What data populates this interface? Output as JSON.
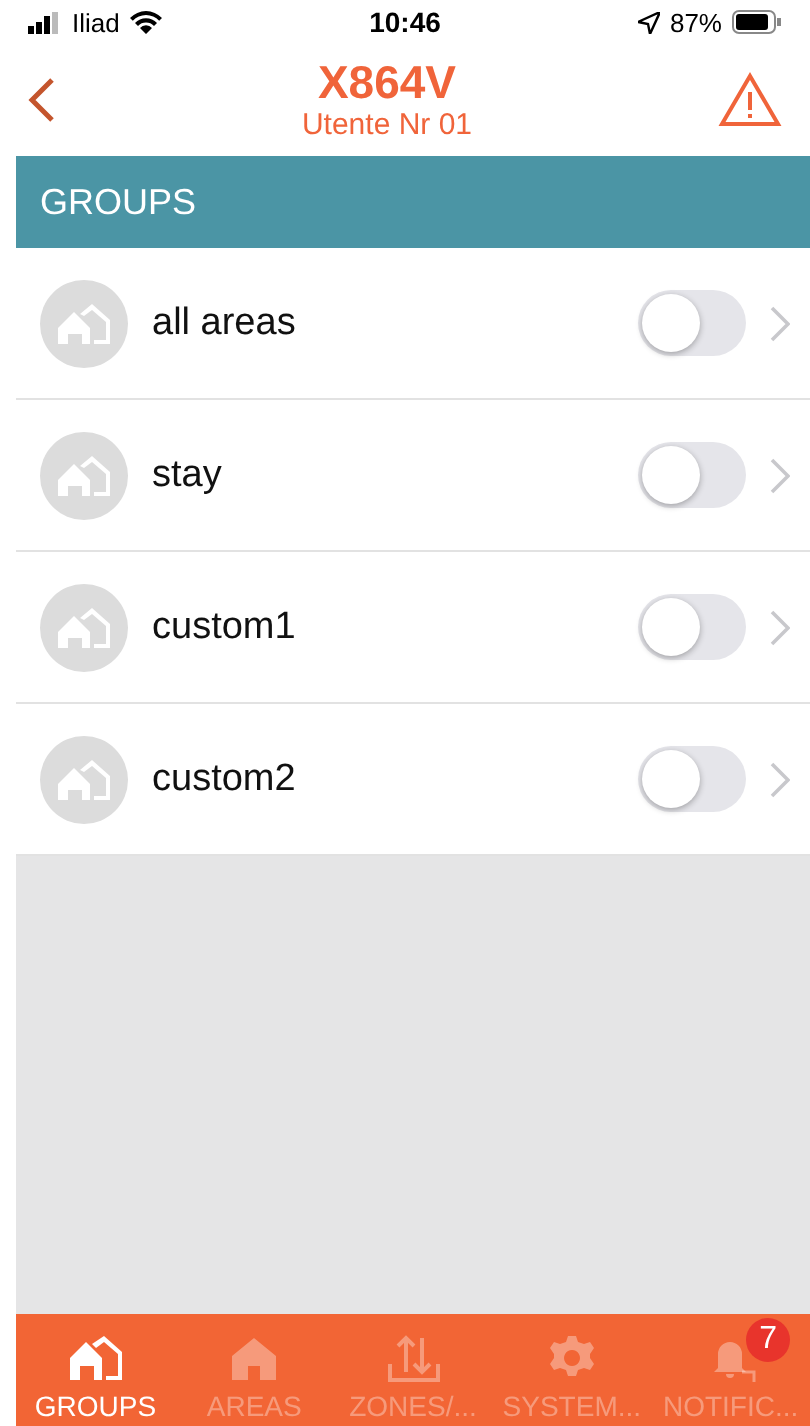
{
  "status_bar": {
    "carrier": "Iliad",
    "time": "10:46",
    "battery": "87%"
  },
  "nav": {
    "title": "X864V",
    "subtitle": "Utente Nr 01"
  },
  "section": {
    "title": "GROUPS"
  },
  "groups": [
    {
      "name": "all areas",
      "on": false
    },
    {
      "name": "stay",
      "on": false
    },
    {
      "name": "custom1",
      "on": false
    },
    {
      "name": "custom2",
      "on": false
    }
  ],
  "tabs": [
    {
      "kind": "groups",
      "label": "GROUPS",
      "selected": true
    },
    {
      "kind": "areas",
      "label": "AREAS",
      "selected": false
    },
    {
      "kind": "zones",
      "label": "ZONES/...",
      "selected": false
    },
    {
      "kind": "system",
      "label": "SYSTEM...",
      "selected": false
    },
    {
      "kind": "notifications",
      "label": "NOTIFIC...",
      "selected": false,
      "badge": "7"
    }
  ]
}
